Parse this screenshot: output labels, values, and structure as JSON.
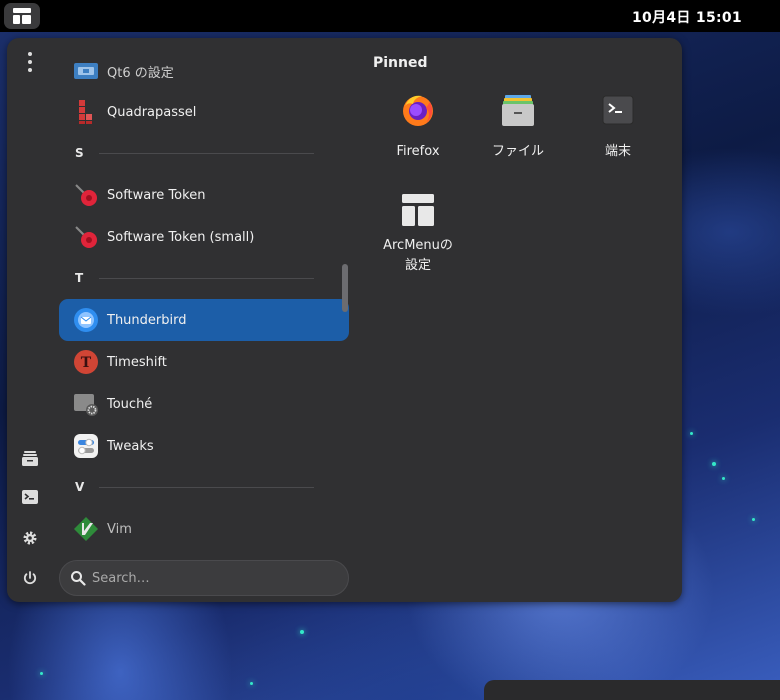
{
  "topbar": {
    "clock": "10月4日  15:01"
  },
  "menu": {
    "sections": {
      "s": "S",
      "t": "T",
      "v": "V"
    },
    "apps": [
      {
        "label": "Qt6 の設定",
        "icon": "qt-settings-icon"
      },
      {
        "label": "Quadrapassel",
        "icon": "quadrapassel-icon"
      },
      {
        "label": "Software Token",
        "icon": "software-token-icon"
      },
      {
        "label": "Software Token (small)",
        "icon": "software-token-icon"
      },
      {
        "label": "Thunderbird",
        "icon": "thunderbird-icon",
        "selected": true
      },
      {
        "label": "Timeshift",
        "icon": "timeshift-icon"
      },
      {
        "label": "Touché",
        "icon": "touche-icon"
      },
      {
        "label": "Tweaks",
        "icon": "tweaks-icon"
      },
      {
        "label": "Vim",
        "icon": "vim-icon"
      }
    ],
    "search": {
      "placeholder": "Search…"
    },
    "pinned": {
      "title": "Pinned",
      "items": [
        {
          "label": "Firefox",
          "icon": "firefox-icon"
        },
        {
          "label": "ファイル",
          "icon": "files-icon"
        },
        {
          "label": "端末",
          "icon": "terminal-icon"
        },
        {
          "label": "ArcMenuの\n設定",
          "line1": "ArcMenuの",
          "line2": "設定",
          "icon": "arcmenu-settings-icon"
        }
      ]
    },
    "sidebar": [
      "kebab-menu-icon",
      "files-icon",
      "terminal-icon",
      "gear-icon",
      "power-icon"
    ]
  },
  "colors": {
    "panel": "#303032",
    "selection": "#1c5ea8",
    "topbar": "#000000"
  }
}
